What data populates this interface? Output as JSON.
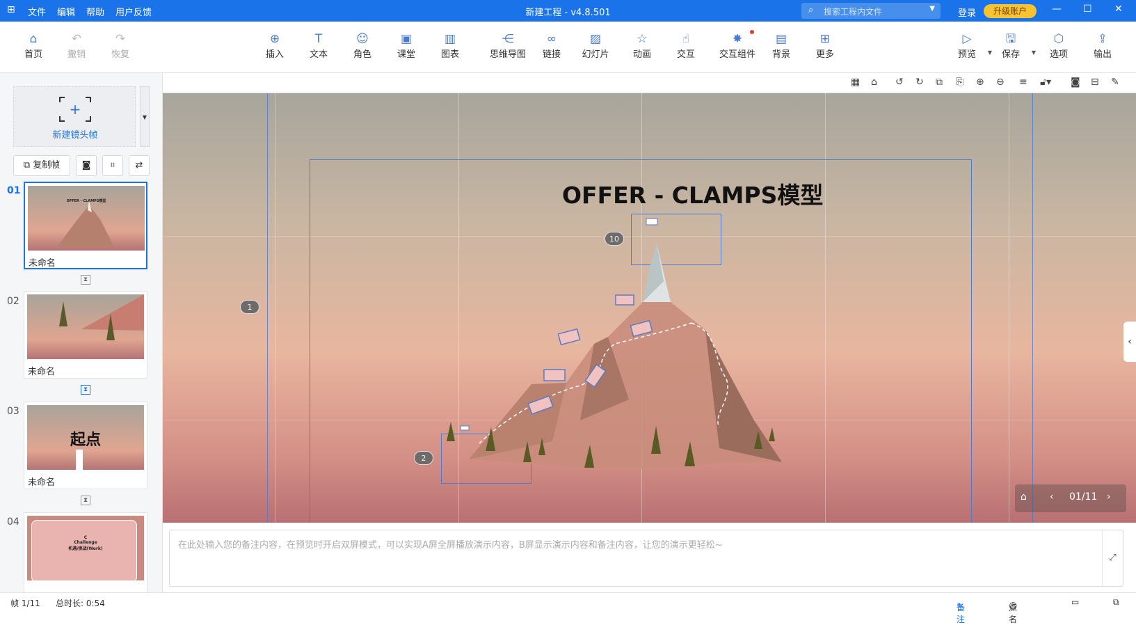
{
  "app": {
    "title": "新建工程 - v4.8.501",
    "menu": [
      "文件",
      "编辑",
      "帮助",
      "用户反馈"
    ],
    "search_placeholder": "搜索工程内文件",
    "login": "登录",
    "upgrade": "升级账户"
  },
  "toolbar": {
    "left": [
      {
        "label": "首页",
        "icon": "home-icon"
      },
      {
        "label": "撤销",
        "icon": "undo-icon"
      },
      {
        "label": "恢复",
        "icon": "redo-icon"
      }
    ],
    "center": [
      {
        "label": "插入",
        "icon": "plus-circle-icon"
      },
      {
        "label": "文本",
        "icon": "text-icon"
      },
      {
        "label": "角色",
        "icon": "person-icon"
      },
      {
        "label": "课堂",
        "icon": "classroom-icon"
      },
      {
        "label": "图表",
        "icon": "chart-icon"
      },
      {
        "label": "思维导图",
        "icon": "mindmap-icon"
      },
      {
        "label": "链接",
        "icon": "link-icon"
      },
      {
        "label": "幻灯片",
        "icon": "slide-icon"
      },
      {
        "label": "动画",
        "icon": "star-icon"
      },
      {
        "label": "交互",
        "icon": "pointer-icon"
      },
      {
        "label": "交互组件",
        "icon": "interactive-component-icon"
      },
      {
        "label": "背景",
        "icon": "background-icon"
      },
      {
        "label": "更多",
        "icon": "grid-icon"
      }
    ],
    "right": [
      {
        "label": "预览",
        "icon": "preview-icon"
      },
      {
        "label": "保存",
        "icon": "save-icon"
      },
      {
        "label": "选项",
        "icon": "settings-icon"
      },
      {
        "label": "输出",
        "icon": "export-icon"
      }
    ]
  },
  "left_panel": {
    "new_frame": "新建镜头帧",
    "copy_frame": "复制帧",
    "thumbnails": [
      {
        "num": "01",
        "name": "未命名",
        "caption": "OFFER - CLAMPS模型",
        "active": true
      },
      {
        "num": "02",
        "name": "未命名",
        "caption": "",
        "active": false
      },
      {
        "num": "03",
        "name": "未命名",
        "caption": "起点",
        "active": false
      },
      {
        "num": "04",
        "name": "",
        "caption": "C\nChallenge\n机遇/挑战(Work)",
        "active": false
      }
    ]
  },
  "canvas": {
    "title": "OFFER - CLAMPS模型",
    "badges": [
      "10",
      "1",
      "2"
    ],
    "page_indicator": "01/11"
  },
  "notes": {
    "placeholder": "在此处输入您的备注内容，在预览时开启双屏模式，可以实现A屏全屏播放演示内容，B屏显示演示内容和备注内容，让您的演示更轻松~"
  },
  "status": {
    "frame": "帧 1/11",
    "duration": "总时长: 0:54",
    "notes_btn": "备注",
    "rollcall_btn": "点名"
  }
}
